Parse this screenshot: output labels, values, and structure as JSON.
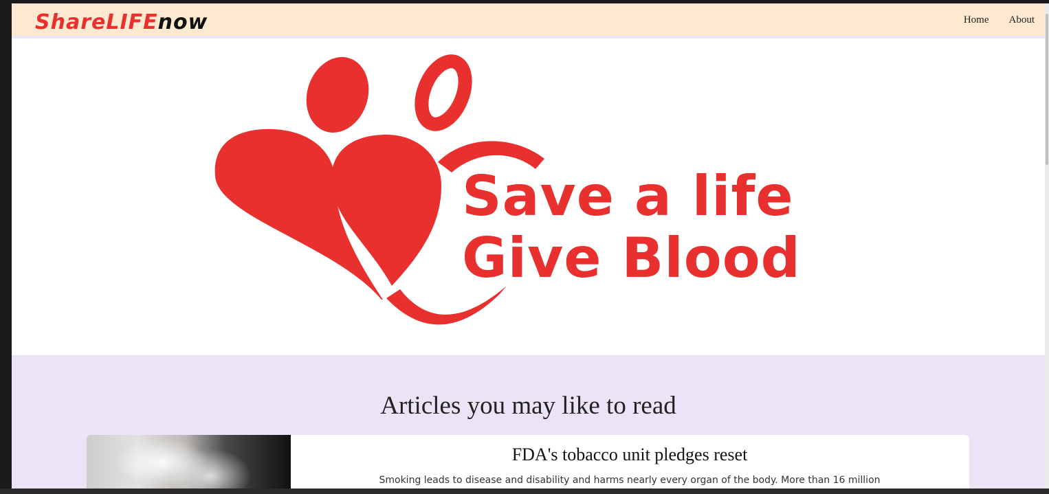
{
  "brand": {
    "part1": "ShareLIFE",
    "part2": "now"
  },
  "nav": {
    "home": "Home",
    "about": "About"
  },
  "hero": {
    "line1": "Save a life",
    "line2": "Give Blood",
    "color": "#e8312f"
  },
  "articles": {
    "heading": "Articles you may like to read",
    "items": [
      {
        "title": "FDA's tobacco unit pledges reset",
        "snippet": "Smoking leads to disease and disability and harms nearly every organ of the body. More than 16 million"
      }
    ]
  },
  "colors": {
    "navbar_bg": "#fde9cf",
    "section_bg": "#ebe4f6",
    "brand_red": "#e8312f"
  }
}
